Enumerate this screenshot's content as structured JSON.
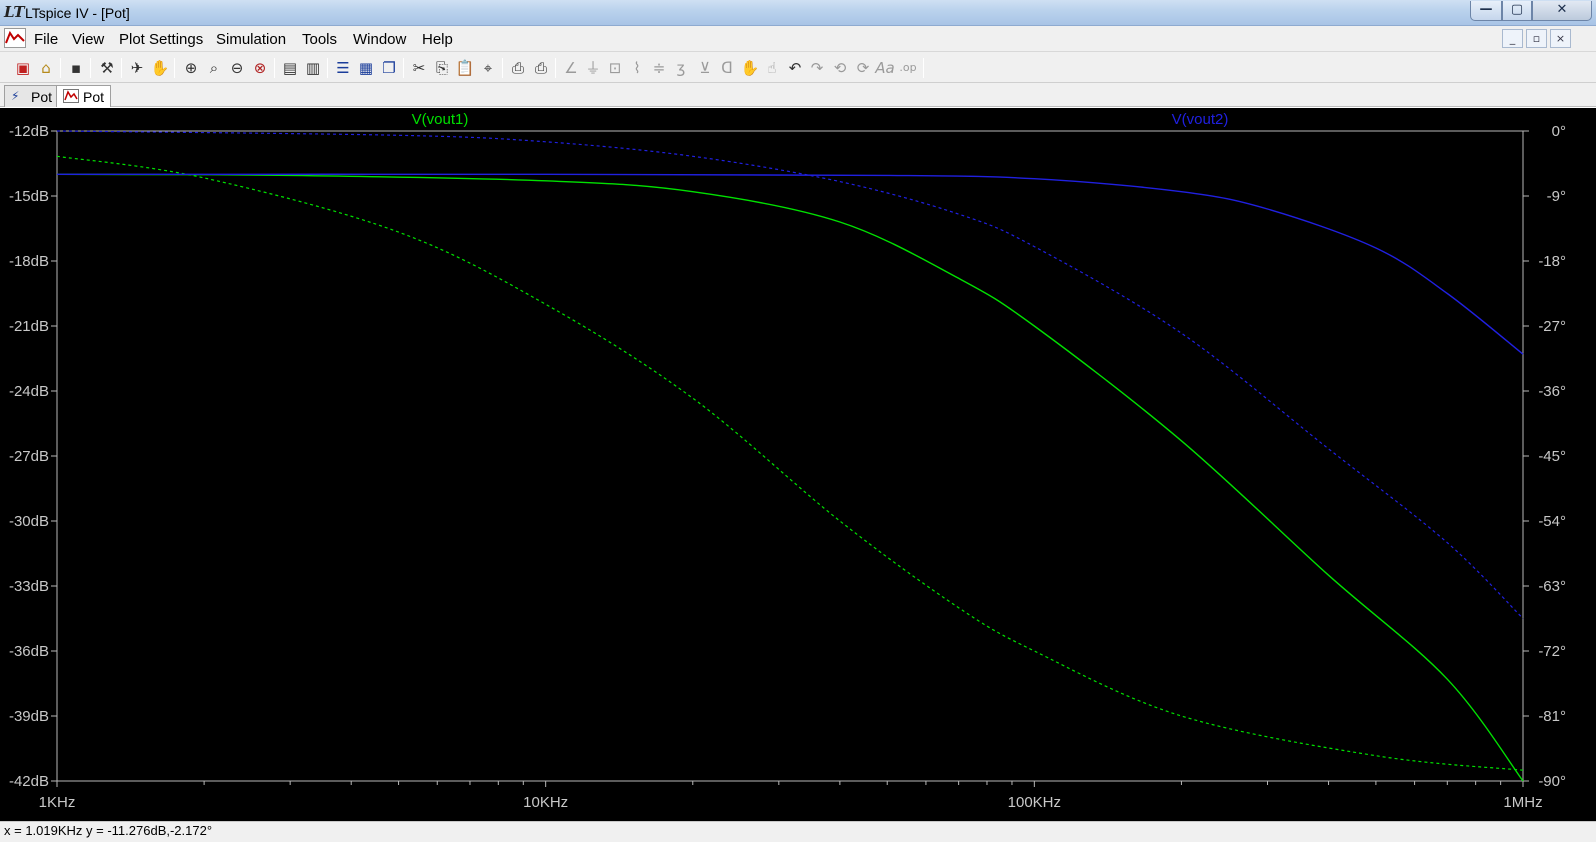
{
  "window": {
    "title": "LTspice IV - [Pot]",
    "controls": {
      "minimize": "—",
      "maximize": "▢",
      "close": "✕"
    }
  },
  "menu": {
    "items": [
      "File",
      "View",
      "Plot Settings",
      "Simulation",
      "Tools",
      "Window",
      "Help"
    ],
    "mdi_controls": {
      "minimize": "_",
      "restore": "▫",
      "close": "×"
    }
  },
  "toolbar": {
    "icons": [
      "new-schematic-icon",
      "open-file-icon",
      "save-icon",
      "control-panel-icon",
      "run-icon",
      "halt-icon",
      "zoom-in-icon",
      "zoom-area-icon",
      "zoom-out-icon",
      "zoom-fit-icon",
      "autorange-icon",
      "tile-icon",
      "vertical-tile-icon",
      "cascade-icon",
      "cut-icon",
      "copy-icon",
      "paste-icon",
      "find-icon",
      "print-preview-icon",
      "print-icon",
      "wire-icon",
      "ground-icon",
      "label-icon",
      "resistor-icon",
      "capacitor-icon",
      "inductor-icon",
      "diode-icon",
      "component-icon",
      "move-icon",
      "drag-icon",
      "undo-icon",
      "redo-icon",
      "rotate-icon",
      "mirror-icon",
      "text-icon",
      "spice-directive-icon"
    ]
  },
  "tabs": [
    {
      "label": "Pot",
      "kind": "schematic"
    },
    {
      "label": "Pot",
      "kind": "waveform"
    }
  ],
  "plot": {
    "traces": [
      {
        "name": "V(vout1)",
        "color": "#00e000"
      },
      {
        "name": "V(vout2)",
        "color": "#2020e0"
      }
    ]
  },
  "chart_data": {
    "type": "line",
    "x_scale": "log",
    "x_unit": "Hz",
    "xlim": [
      1000,
      1000000
    ],
    "x_ticks": [
      1000,
      10000,
      100000,
      1000000
    ],
    "x_tick_labels": [
      "1KHz",
      "10KHz",
      "100KHz",
      "1MHz"
    ],
    "ylim": [
      -42,
      -12
    ],
    "y_ticks": [
      -12,
      -15,
      -18,
      -21,
      -24,
      -27,
      -30,
      -33,
      -36,
      -39,
      -42
    ],
    "y_tick_labels": [
      "-12dB",
      "-15dB",
      "-18dB",
      "-21dB",
      "-24dB",
      "-27dB",
      "-30dB",
      "-33dB",
      "-36dB",
      "-39dB",
      "-42dB"
    ],
    "y2lim": [
      -90,
      0
    ],
    "y2_ticks": [
      0,
      -9,
      -18,
      -27,
      -36,
      -45,
      -54,
      -63,
      -72,
      -81,
      -90
    ],
    "y2_tick_labels": [
      "0°",
      "-9°",
      "-18°",
      "-27°",
      "-36°",
      "-45°",
      "-54°",
      "-63°",
      "-72°",
      "-81°",
      "-90°"
    ],
    "grid": false,
    "series": [
      {
        "name": "V(vout1)",
        "quantity": "magnitude",
        "axis": "left",
        "color": "#00e000",
        "x": [
          1000,
          3000,
          10000,
          20000,
          40000,
          70000,
          100000,
          200000,
          400000,
          700000,
          1000000
        ],
        "y": [
          -14.0,
          -14.05,
          -14.3,
          -14.8,
          -16.2,
          -18.8,
          -21.0,
          -26.3,
          -32.5,
          -37.3,
          -42.0
        ]
      },
      {
        "name": "V(vout1)",
        "quantity": "phase",
        "axis": "right",
        "color": "#00e000",
        "dashed": true,
        "x": [
          1000,
          2000,
          5000,
          10000,
          20000,
          40000,
          70000,
          100000,
          200000,
          500000,
          1000000
        ],
        "y": [
          -3.5,
          -6.5,
          -14.0,
          -24.0,
          -37.0,
          -54.0,
          -66.0,
          -72.0,
          -81.0,
          -86.5,
          -88.5
        ]
      },
      {
        "name": "V(vout2)",
        "quantity": "magnitude",
        "axis": "left",
        "color": "#2020e0",
        "x": [
          1000,
          10000,
          50000,
          100000,
          200000,
          300000,
          500000,
          700000,
          1000000
        ],
        "y": [
          -14.0,
          -14.0,
          -14.05,
          -14.2,
          -14.8,
          -15.6,
          -17.4,
          -19.5,
          -22.3
        ]
      },
      {
        "name": "V(vout2)",
        "quantity": "phase",
        "axis": "right",
        "color": "#2020e0",
        "dashed": true,
        "x": [
          1000,
          5000,
          10000,
          20000,
          40000,
          70000,
          100000,
          200000,
          400000,
          700000,
          1000000
        ],
        "y": [
          0.0,
          -0.6,
          -1.5,
          -3.5,
          -7.0,
          -11.5,
          -16.0,
          -28.0,
          -44.0,
          -57.0,
          -67.5
        ]
      }
    ]
  },
  "status": {
    "text": "x = 1.019KHz    y = -11.276dB,-2.172°"
  }
}
